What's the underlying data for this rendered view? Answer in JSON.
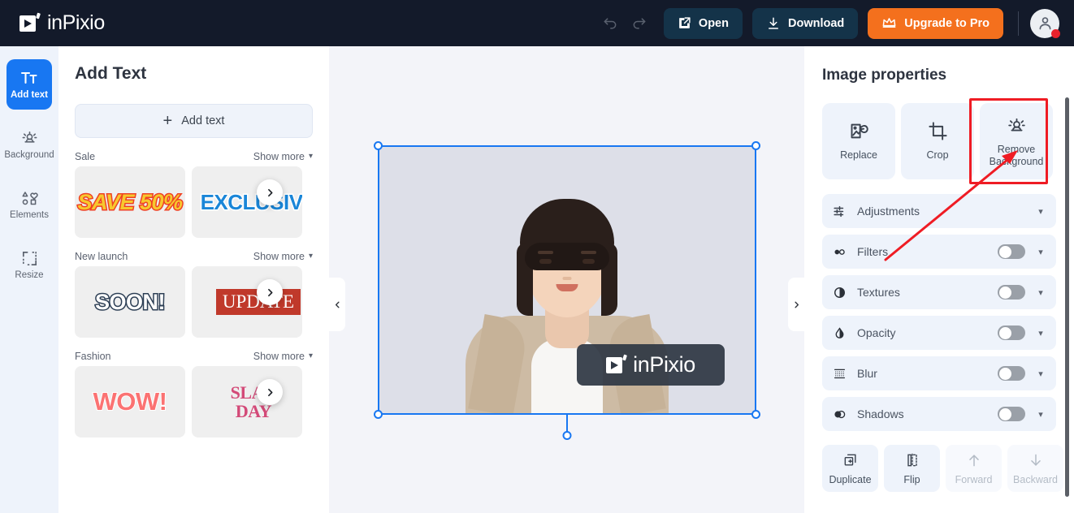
{
  "app": {
    "brand": "inPixio"
  },
  "topbar": {
    "undo_icon": "undo-icon",
    "redo_icon": "redo-icon",
    "open_label": "Open",
    "download_label": "Download",
    "upgrade_label": "Upgrade to Pro",
    "account_icon": "user-avatar-icon",
    "colors": {
      "background": "#131a2a",
      "dark_button": "#143349",
      "accent_orange": "#f4701d"
    }
  },
  "rail": {
    "items": [
      {
        "label": "Add text",
        "icon": "text-format-icon",
        "active": true
      },
      {
        "label": "Background",
        "icon": "background-remove-icon",
        "active": false
      },
      {
        "label": "Elements",
        "icon": "shapes-icon",
        "active": false
      },
      {
        "label": "Resize",
        "icon": "resize-crop-icon",
        "active": false
      }
    ],
    "active_color": "#1877f2"
  },
  "left_panel": {
    "title": "Add Text",
    "add_text_button": "Add text",
    "categories": [
      {
        "name": "Sale",
        "show_more": "Show more",
        "thumbs": [
          {
            "text": "SAVE 50%",
            "style": "art-save"
          },
          {
            "text": "EXCLUSIVE",
            "style": "art-excl"
          }
        ]
      },
      {
        "name": "New launch",
        "show_more": "Show more",
        "thumbs": [
          {
            "text": "SOON!",
            "style": "art-soon"
          },
          {
            "text": "UPDATE",
            "style": "art-update"
          }
        ]
      },
      {
        "name": "Fashion",
        "show_more": "Show more",
        "thumbs": [
          {
            "text": "WOW!",
            "style": "art-wow"
          },
          {
            "text": "SLAU\nDAY",
            "style": "art-slau"
          }
        ]
      }
    ]
  },
  "canvas": {
    "collapse_left_icon": "chevron-left-icon",
    "collapse_right_icon": "chevron-right-icon",
    "watermark_text": "inPixio",
    "selection_color": "#1877f2",
    "background": "#f3f4f9"
  },
  "right_panel": {
    "title": "Image properties",
    "tools": [
      {
        "label": "Replace",
        "icon": "replace-image-icon"
      },
      {
        "label": "Crop",
        "icon": "crop-icon"
      },
      {
        "label": "Remove\nBackground",
        "icon": "remove-background-icon",
        "highlighted": true
      }
    ],
    "rows": [
      {
        "label": "Adjustments",
        "icon": "sliders-icon",
        "toggle": false,
        "has_toggle": false
      },
      {
        "label": "Filters",
        "icon": "filters-icon",
        "toggle": false,
        "has_toggle": true
      },
      {
        "label": "Textures",
        "icon": "textures-icon",
        "toggle": false,
        "has_toggle": true
      },
      {
        "label": "Opacity",
        "icon": "opacity-droplet-icon",
        "toggle": false,
        "has_toggle": true
      },
      {
        "label": "Blur",
        "icon": "blur-icon",
        "toggle": false,
        "has_toggle": true
      },
      {
        "label": "Shadows",
        "icon": "shadows-icon",
        "toggle": false,
        "has_toggle": true
      }
    ],
    "actions": [
      {
        "label": "Duplicate",
        "icon": "duplicate-icon",
        "disabled": false
      },
      {
        "label": "Flip",
        "icon": "flip-horizontal-icon",
        "disabled": false
      },
      {
        "label": "Forward",
        "icon": "arrow-up-icon",
        "disabled": true
      },
      {
        "label": "Backward",
        "icon": "arrow-down-icon",
        "disabled": true
      }
    ],
    "highlight_color": "#ef1c24"
  }
}
